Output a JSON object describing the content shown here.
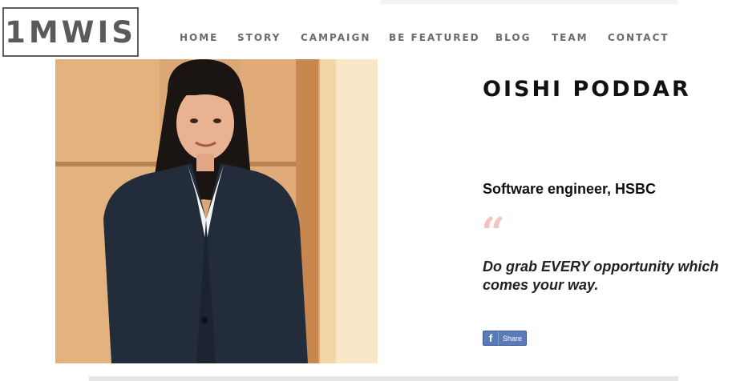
{
  "brand": {
    "logo": "1MWIS"
  },
  "nav": {
    "items": [
      "HOME",
      "STORY",
      "CAMPAIGN",
      "BE FEATURED",
      "BLOG",
      "TEAM",
      "CONTACT"
    ]
  },
  "profile": {
    "name": "OISHI PODDAR",
    "role": "Software engineer, HSBC",
    "quote_mark": "“",
    "quote": "Do grab EVERY opportunity which comes your way."
  },
  "share": {
    "icon": "f",
    "label": "Share",
    "icon_name": "facebook-icon"
  },
  "colors": {
    "accent_quote": "#f2c4c4",
    "share_blue": "#5b7bb8",
    "text": "#111111",
    "nav": "#6a6a6a"
  }
}
